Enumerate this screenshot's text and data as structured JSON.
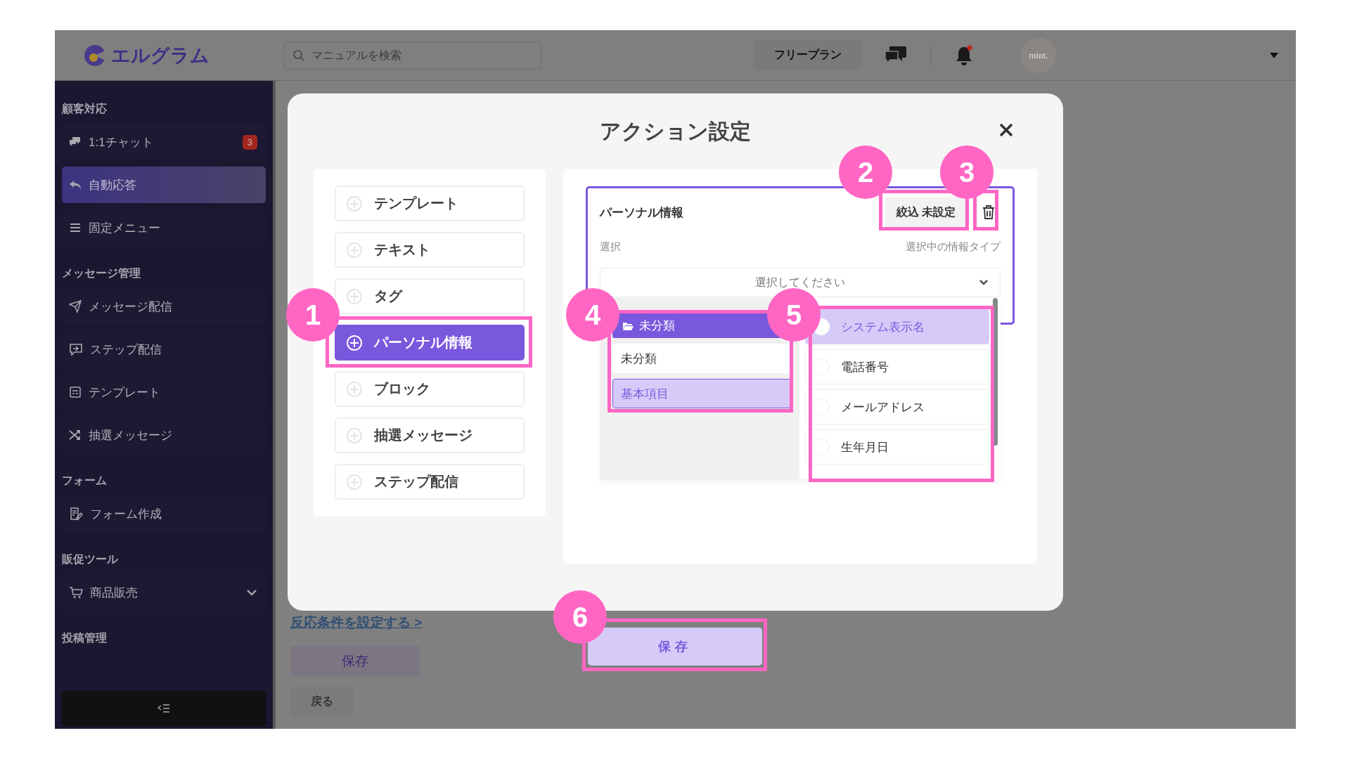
{
  "header": {
    "logo": "エルグラム",
    "search": {
      "placeholder": "マニュアルを検索"
    },
    "plan": "フリープラン",
    "avatar": "mint.",
    "notification": true
  },
  "sidebar": {
    "sections": [
      {
        "title": "顧客対応",
        "items": [
          {
            "label": "1:1チャット",
            "badge": "3",
            "selected": false
          },
          {
            "label": "自動応答",
            "selected": true
          },
          {
            "label": "固定メニュー",
            "selected": false
          }
        ]
      },
      {
        "title": "メッセージ管理",
        "items": [
          {
            "label": "メッセージ配信",
            "selected": false
          },
          {
            "label": "ステップ配信",
            "selected": false
          },
          {
            "label": "テンプレート",
            "selected": false
          },
          {
            "label": "抽選メッセージ",
            "selected": false
          }
        ]
      },
      {
        "title": "フォーム",
        "items": [
          {
            "label": "フォーム作成",
            "selected": false
          }
        ]
      },
      {
        "title": "販促ツール",
        "items": [
          {
            "label": "商品販売",
            "selected": false,
            "expanded": false
          }
        ]
      },
      {
        "title": "投稿管理"
      }
    ]
  },
  "main": {
    "link": "反応条件を設定する >",
    "buttons": [
      "保存",
      "戻る"
    ]
  },
  "modal": {
    "title": "アクション設定",
    "actions": [
      {
        "label": "テンプレート",
        "selected": false
      },
      {
        "label": "テキスト",
        "selected": false
      },
      {
        "label": "タグ",
        "selected": false
      },
      {
        "label": "パーソナル情報",
        "selected": true
      },
      {
        "label": "ブロック",
        "selected": false
      },
      {
        "label": "抽選メッセージ",
        "selected": false
      },
      {
        "label": "ステップ配信",
        "selected": false
      }
    ],
    "card": {
      "title": "パーソナル情報",
      "filter_button": "絞込 未設定",
      "select_label": "選択",
      "type_label": "選択中の情報タイプ",
      "select": {
        "placeholder": "選択してください"
      },
      "folders": [
        {
          "kind": "header",
          "label": "未分類"
        },
        {
          "kind": "item",
          "label": "未分類",
          "selected": false
        },
        {
          "kind": "item",
          "label": "基本項目",
          "selected": true
        }
      ],
      "fields": [
        {
          "label": "システム表示名",
          "selected": true
        },
        {
          "label": "電話番号",
          "selected": false
        },
        {
          "label": "メールアドレス",
          "selected": false
        },
        {
          "label": "生年月日",
          "selected": false
        }
      ]
    },
    "save_button": "保存"
  },
  "annotations": [
    "1",
    "2",
    "3",
    "4",
    "5",
    "6"
  ]
}
